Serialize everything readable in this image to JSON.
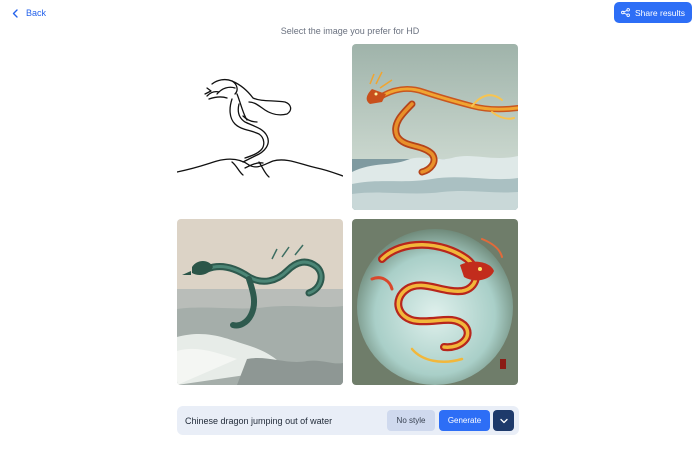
{
  "header": {
    "back_label": "Back",
    "share_label": "Share results"
  },
  "main": {
    "title": "Select the image you prefer for HD",
    "images": [
      {
        "icon": "sketch-dragon-icon",
        "description_hidden": true
      },
      {
        "icon": "golden-dragon-icon"
      },
      {
        "icon": "teal-dragon-icon"
      },
      {
        "icon": "red-gold-dragon-icon"
      }
    ]
  },
  "prompt_bar": {
    "prompt_value": "Chinese dragon jumping out of water",
    "style_label": "No style",
    "generate_label": "Generate"
  },
  "colors": {
    "accent": "#2d6ef6",
    "dark_accent": "#1e3a6b",
    "bar_bg": "#e9eef7"
  }
}
